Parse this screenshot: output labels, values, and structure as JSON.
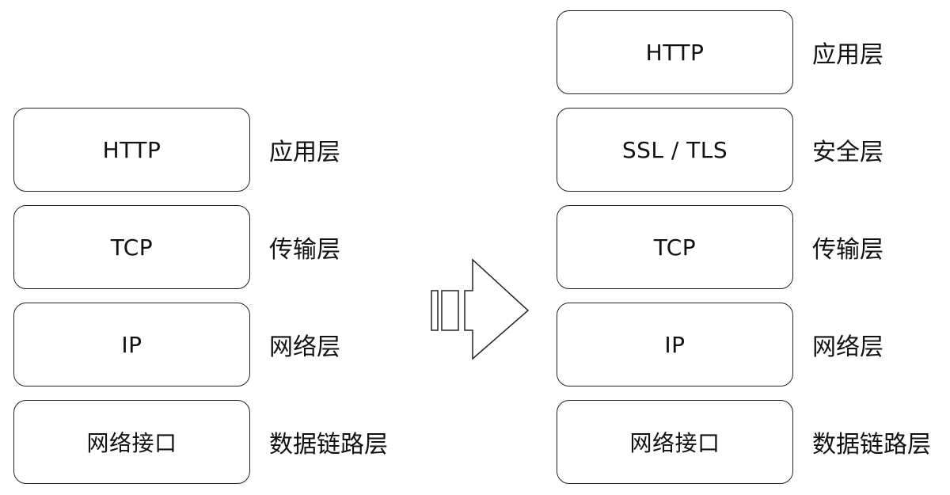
{
  "left_stack": [
    {
      "layer": "HTTP",
      "name": "应用层"
    },
    {
      "layer": "TCP",
      "name": "传输层"
    },
    {
      "layer": "IP",
      "name": "网络层"
    },
    {
      "layer": "网络接口",
      "name": "数据链路层"
    }
  ],
  "right_stack": [
    {
      "layer": "HTTP",
      "name": "应用层"
    },
    {
      "layer": "SSL / TLS",
      "name": "安全层"
    },
    {
      "layer": "TCP",
      "name": "传输层"
    },
    {
      "layer": "IP",
      "name": "网络层"
    },
    {
      "layer": "网络接口",
      "name": "数据链路层"
    }
  ],
  "arrow_icon": "right-arrow-icon"
}
